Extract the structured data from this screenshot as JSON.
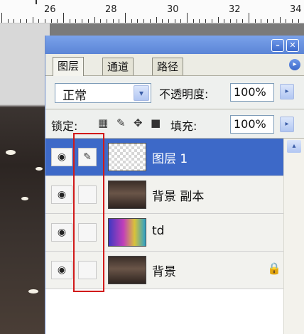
{
  "ruler": {
    "labels": [
      "26",
      "28",
      "30",
      "32",
      "34"
    ]
  },
  "panel": {
    "tabs": [
      "图层",
      "通道",
      "路径"
    ],
    "blend_mode": "正常",
    "opacity_label": "不透明度:",
    "opacity_value": "100%",
    "lock_label": "锁定:",
    "fill_label": "填充:",
    "fill_value": "100%",
    "layers": [
      {
        "name": "图层 1",
        "selected": true,
        "thumb": "transparent"
      },
      {
        "name": "背景 副本",
        "selected": false,
        "thumb": "room"
      },
      {
        "name": "td",
        "selected": false,
        "thumb": "color"
      },
      {
        "name": "背景",
        "selected": false,
        "thumb": "room",
        "locked": true
      }
    ]
  },
  "colors": {
    "selection": "#3d69c8",
    "highlight_box": "#d11a1a",
    "titlebar": "#6f97e4"
  },
  "icons": [
    "eye-icon",
    "brush-link-icon",
    "lock-icon",
    "move-icon",
    "transparency-lock-icon",
    "dropdown-arrow-icon",
    "minimize-icon",
    "close-icon",
    "panel-menu-icon"
  ]
}
